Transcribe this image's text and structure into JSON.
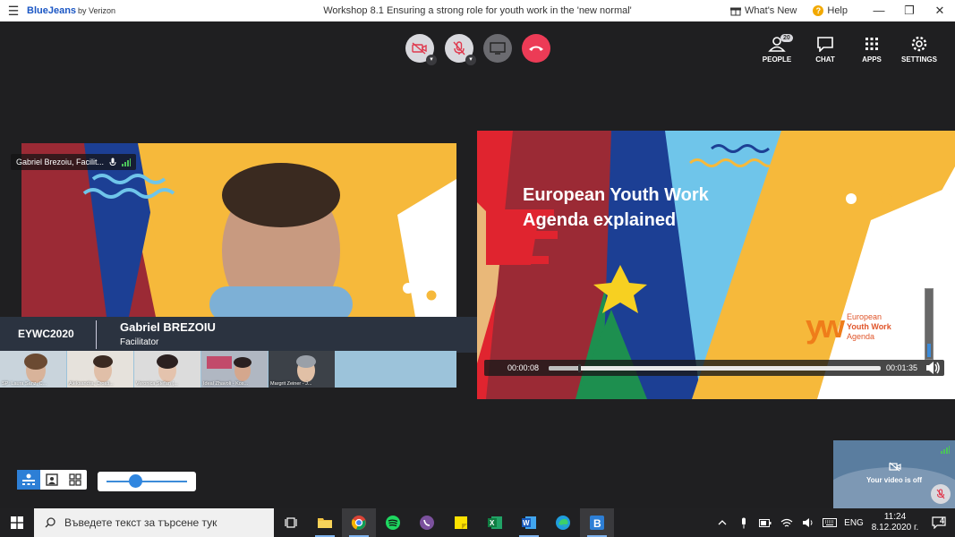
{
  "titlebar": {
    "logo": "BlueJeans",
    "logo_suffix": "by Verizon",
    "title": "Workshop 8.1 Ensuring a strong role for youth work in the 'new normal'",
    "whats_new": "What's New",
    "help": "Help"
  },
  "toolbar": {
    "people_label": "PEOPLE",
    "people_count": "20",
    "chat_label": "CHAT",
    "apps_label": "APPS",
    "settings_label": "SETTINGS"
  },
  "speaker": {
    "chip_name": "Gabriel Brezoiu, Facilit...",
    "brand": "EYWC2020",
    "name": "Gabriel BREZOIU",
    "role": "Facilitator"
  },
  "participants": [
    {
      "label": "SP: Laura Sanz, C..."
    },
    {
      "label": "Aleksandra, Croati..."
    },
    {
      "label": "Veronica Stefan (..."
    },
    {
      "label": "Ideal Zhavoli - Kos..."
    },
    {
      "label": "Margrit Zeiner - J..."
    }
  ],
  "slide": {
    "title": "European Youth Work Agenda explained",
    "logo_mark": "yw",
    "logo_line1": "European",
    "logo_line2": "Youth Work",
    "logo_line3": "Agenda"
  },
  "player": {
    "current_time": "00:00:08",
    "duration": "00:01:35",
    "progress": 0.09,
    "volume": 0.2
  },
  "zoom": {
    "level": 0.35
  },
  "selfview": {
    "text": "Your video is off"
  },
  "taskbar": {
    "search_placeholder": "Въведете текст за търсене тук",
    "language": "ENG",
    "time": "11:24",
    "date": "8.12.2020 г.",
    "notifications": "4"
  },
  "colors": {
    "accent_blue": "#2d7fd6",
    "hangup_red": "#ec3b56",
    "slide_red": "#e0242f",
    "slide_yellow": "#f6b93b",
    "slide_blue": "#1c3f94",
    "slide_green": "#1d8f4f"
  }
}
